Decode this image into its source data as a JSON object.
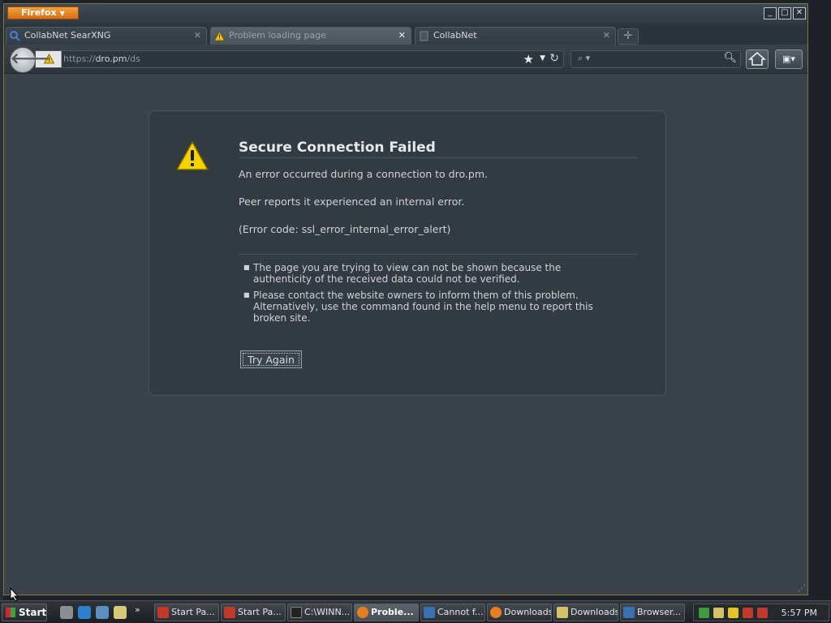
{
  "window": {
    "app_button": "Firefox",
    "controls": {
      "minimize": "_",
      "maximize": "□",
      "close": "✕"
    }
  },
  "tabs": [
    {
      "label": "CollabNet SearXNG",
      "icon": "search-icon",
      "active": false
    },
    {
      "label": "Problem loading page",
      "icon": "warning-icon",
      "active": true
    },
    {
      "label": "CollabNet",
      "icon": "page-icon",
      "active": false
    }
  ],
  "navbar": {
    "url_scheme": "https://",
    "url_host": "dro.pm",
    "url_path": "/ds",
    "search_placeholder": ""
  },
  "error_page": {
    "title": "Secure Connection Failed",
    "message1": "An error occurred during a connection to dro.pm.",
    "message2": "Peer reports it experienced an internal error.",
    "error_code": "(Error code: ssl_error_internal_error_alert)",
    "bullets": [
      "The page you are trying to view can not be shown because the authenticity of the received data could not be verified.",
      "Please contact the website owners to inform them of this problem. Alternatively, use the command found in the help menu to report this broken site."
    ],
    "try_again": "Try Again"
  },
  "taskbar": {
    "start": "Start",
    "tasks": [
      {
        "label": "Start Pa...",
        "icon_color": "#c0392b"
      },
      {
        "label": "Start Pa...",
        "icon_color": "#c0392b"
      },
      {
        "label": "C:\\WINN...",
        "icon_color": "#222222"
      },
      {
        "label": "Proble...",
        "icon_color": "#e67e22",
        "active": true
      },
      {
        "label": "Cannot f...",
        "icon_color": "#3a6fb0"
      },
      {
        "label": "Downloads",
        "icon_color": "#e67e22"
      },
      {
        "label": "Downloads",
        "icon_color": "#d4c26a"
      },
      {
        "label": "Browser...",
        "icon_color": "#3a6fb0"
      }
    ],
    "clock": "5:57 PM",
    "overflow": "»"
  }
}
